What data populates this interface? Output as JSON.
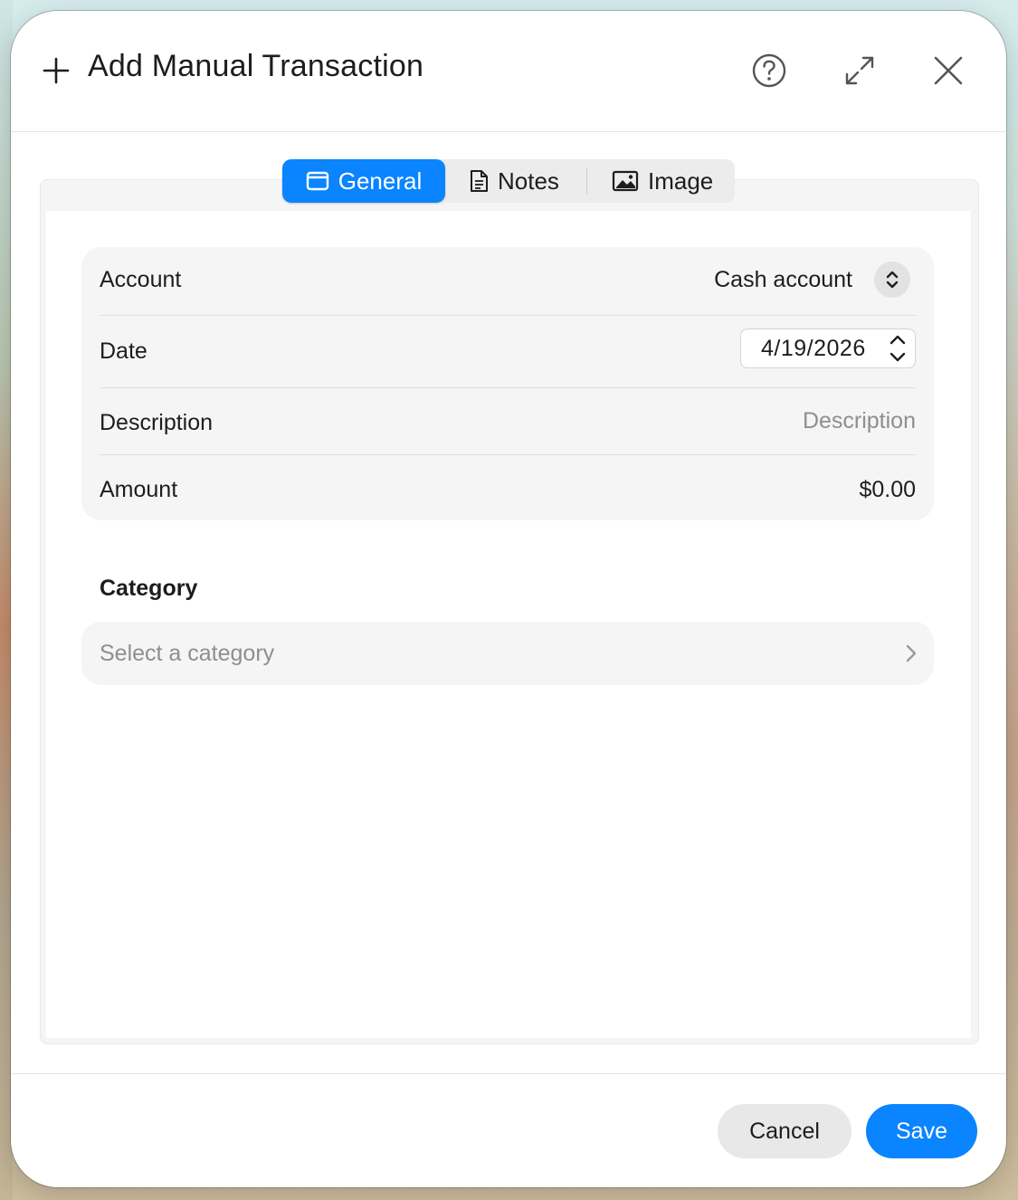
{
  "dialog": {
    "title": "Add Manual Transaction",
    "icons": {
      "add": "plus-icon",
      "help": "help-circle-icon",
      "expand": "expand-icon",
      "close": "close-icon"
    }
  },
  "tabs": [
    {
      "label": "General",
      "icon": "window-icon",
      "active": true
    },
    {
      "label": "Notes",
      "icon": "document-icon",
      "active": false
    },
    {
      "label": "Image",
      "icon": "photo-icon",
      "active": false
    }
  ],
  "form": {
    "account": {
      "label": "Account",
      "value": "Cash account"
    },
    "date": {
      "label": "Date",
      "value": "4/19/2026"
    },
    "description": {
      "label": "Description",
      "placeholder": "Description",
      "value": ""
    },
    "amount": {
      "label": "Amount",
      "value": "$0.00"
    }
  },
  "category": {
    "heading": "Category",
    "placeholder": "Select a category"
  },
  "footer": {
    "cancel_label": "Cancel",
    "save_label": "Save"
  },
  "colors": {
    "accent": "#0a84ff",
    "surface": "#f5f5f5",
    "text": "#1d1d1f",
    "placeholder": "#8e8e93"
  }
}
